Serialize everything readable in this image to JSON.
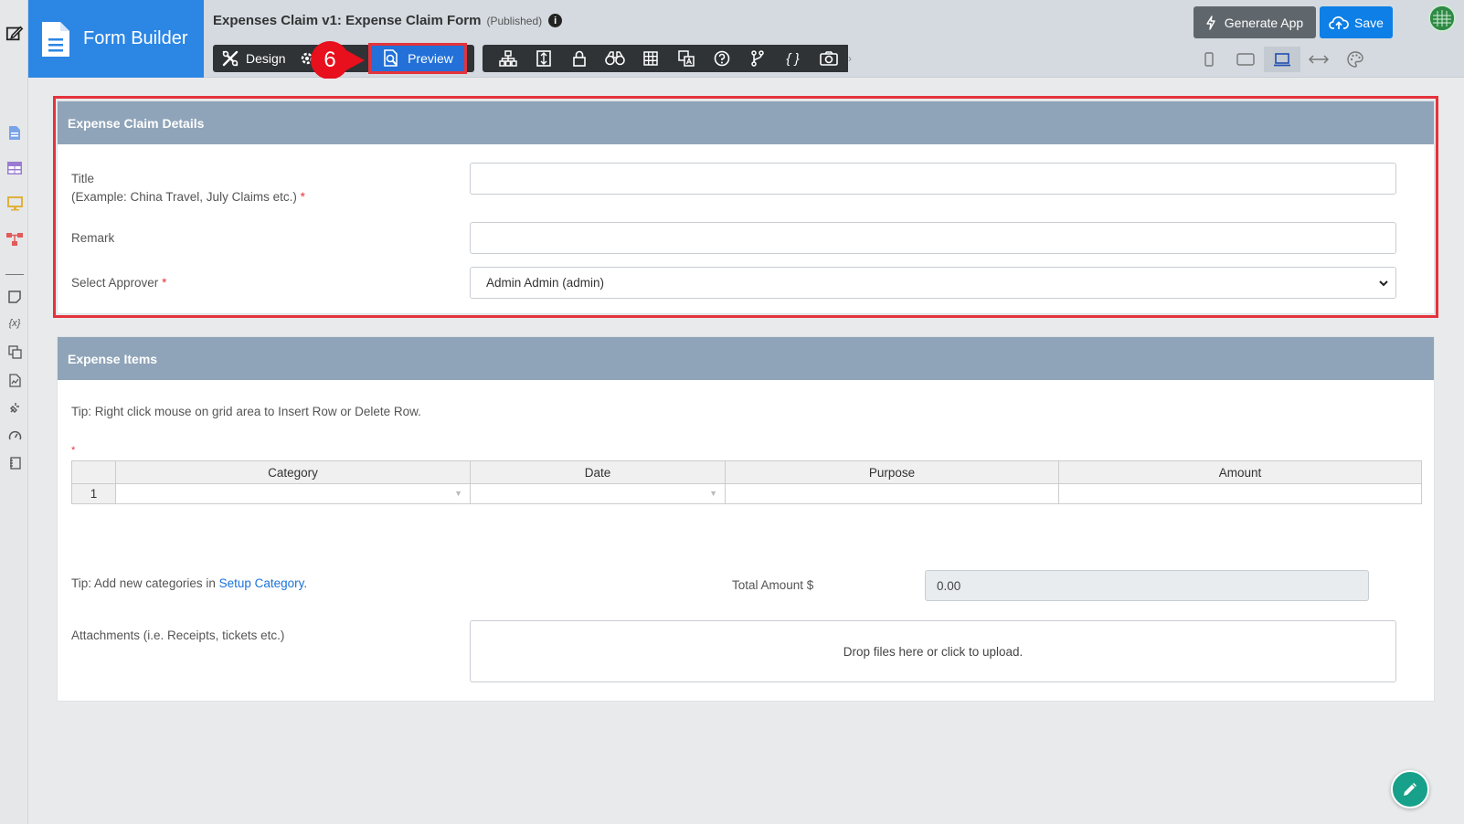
{
  "app": {
    "name": "Form Builder"
  },
  "header": {
    "title": "Expenses Claim v1: Expense Claim Form",
    "status": "(Published)",
    "info": "i"
  },
  "modes": {
    "design_label": "Design",
    "preview_label": "Preview"
  },
  "annotation": {
    "step": "6"
  },
  "actions": {
    "generate_label": "Generate App",
    "save_label": "Save"
  },
  "toolbar_icons": [
    "tree-icon",
    "form-icon",
    "lock-icon",
    "binoculars-icon",
    "grid-icon",
    "translate-icon",
    "help-icon",
    "branch-icon",
    "braces-icon",
    "camera-icon"
  ],
  "braces_glyph": "{ }",
  "chevron": "›",
  "sections": {
    "details": {
      "heading": "Expense Claim Details",
      "title_label": "Title",
      "title_hint": "(Example: China Travel, July Claims etc.)",
      "required_mark": "*",
      "remark_label": "Remark",
      "approver_label": "Select Approver",
      "approver_value": "Admin Admin (admin)"
    },
    "items": {
      "heading": "Expense Items",
      "tip": "Tip: Right click mouse on grid area to Insert Row or Delete Row.",
      "required_mark": "*",
      "columns": [
        "Category",
        "Date",
        "Purpose",
        "Amount"
      ],
      "rows": [
        {
          "num": "1"
        }
      ],
      "dropdown_glyph": "▼",
      "category_tip_prefix": "Tip: Add new categories in ",
      "category_tip_link": "Setup Category",
      "category_tip_suffix": ".",
      "total_label": "Total Amount $",
      "total_value": "0.00",
      "attachments_label": "Attachments (i.e. Receipts, tickets etc.)",
      "dropzone_text": "Drop files here or click to upload."
    }
  },
  "rail_variable_glyph": "{x}",
  "colors": {
    "brand": "#2b86e4",
    "section_header": "#8fa4b8",
    "highlight": "#e4333c",
    "preview": "#2270d8",
    "save": "#0d7fe6",
    "fab": "#17a08a"
  }
}
